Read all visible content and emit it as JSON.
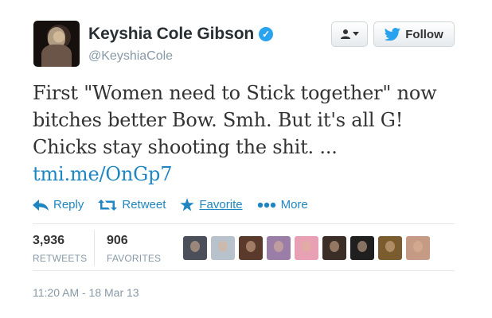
{
  "user": {
    "display_name": "Keyshia Cole Gibson",
    "handle": "@KeyshiaCole",
    "verified": true
  },
  "header": {
    "follow_label": "Follow"
  },
  "tweet": {
    "text": "First \"Women need to Stick together\" now bitches better Bow. Smh. But it's all G! Chicks stay shooting the shit. ...",
    "link": "tmi.me/OnGp7"
  },
  "actions": {
    "reply": "Reply",
    "retweet": "Retweet",
    "favorite": "Favorite",
    "more": "More"
  },
  "stats": {
    "retweets_count": "3,936",
    "retweets_label": "RETWEETS",
    "favorites_count": "906",
    "favorites_label": "FAVORITES"
  },
  "favoriters": [
    {
      "color": "#4a4f5a"
    },
    {
      "color": "#b7c2cc"
    },
    {
      "color": "#5a3b2b"
    },
    {
      "color": "#9b7ea8"
    },
    {
      "color": "#e8a0b5"
    },
    {
      "color": "#3b2e27"
    },
    {
      "color": "#1f1f1f"
    },
    {
      "color": "#7a5c2e"
    },
    {
      "color": "#c69b86"
    }
  ],
  "timestamp": "11:20 AM - 18 Mar 13",
  "colors": {
    "link": "#1f86c2",
    "verified": "#2aa3ef",
    "muted": "#8899a6"
  }
}
